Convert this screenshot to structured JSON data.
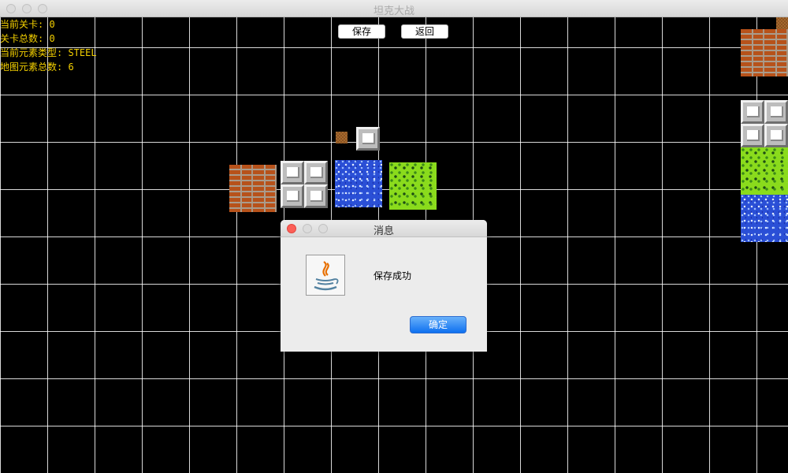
{
  "window": {
    "title": "坦克大战"
  },
  "info": {
    "current_level": "当前关卡: 0",
    "total_levels": "关卡总数: 0",
    "element_type": "当前元素类型: STEEL",
    "element_count": "地图元素总数: 6"
  },
  "toolbar": {
    "save_label": "保存",
    "back_label": "返回"
  },
  "dialog": {
    "title": "消息",
    "message": "保存成功",
    "ok_label": "确定"
  },
  "tile_types": [
    "brick",
    "steel",
    "water",
    "grass"
  ],
  "colors": {
    "info_text": "#f4d000",
    "grid_line": "#ffffff",
    "background": "#000000"
  }
}
